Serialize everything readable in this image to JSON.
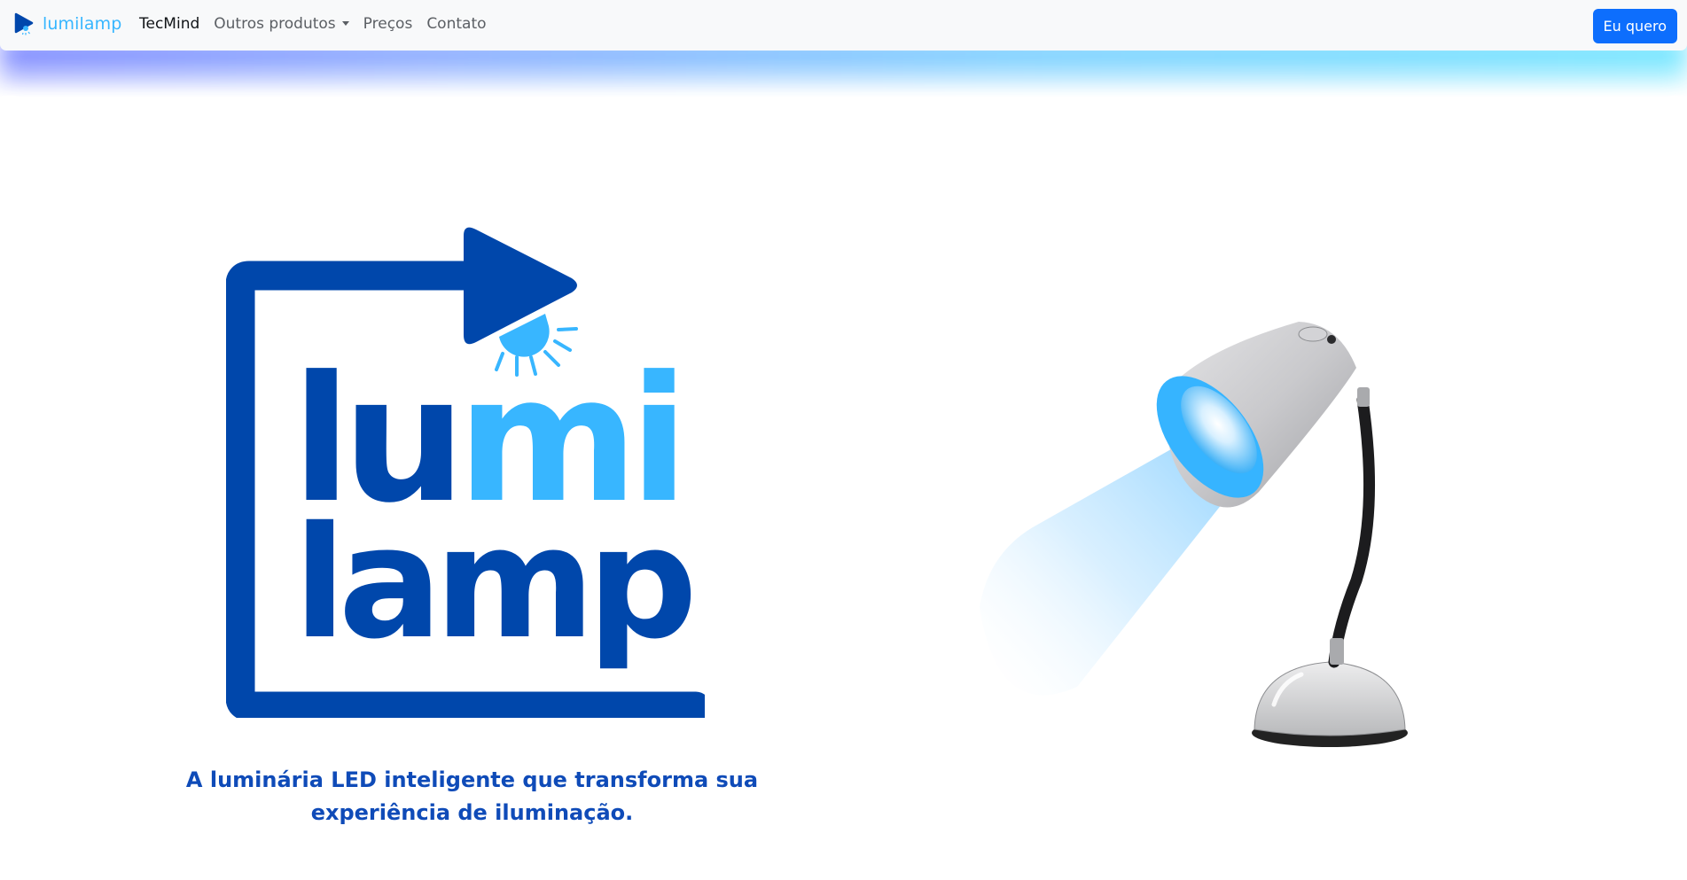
{
  "navbar": {
    "brand": "lumilamp",
    "brand_icon": "play-sun-icon",
    "links": [
      {
        "label": "TecMind",
        "active": true
      },
      {
        "label": "Outros produtos",
        "dropdown": true
      },
      {
        "label": "Preços"
      },
      {
        "label": "Contato"
      }
    ],
    "cta_label": "Eu quero"
  },
  "hero": {
    "logo": {
      "line1_dark": "lu",
      "line1_light": "mi",
      "line2": "lamp"
    },
    "tagline": "A luminária LED inteligente que transforma sua experiência de iluminação.",
    "image": "desk-lamp-illustration"
  },
  "colors": {
    "navy": "#0047ab",
    "light_blue": "#38b6ff",
    "cta": "#0d6efd",
    "tagline": "#0f4bb8"
  }
}
